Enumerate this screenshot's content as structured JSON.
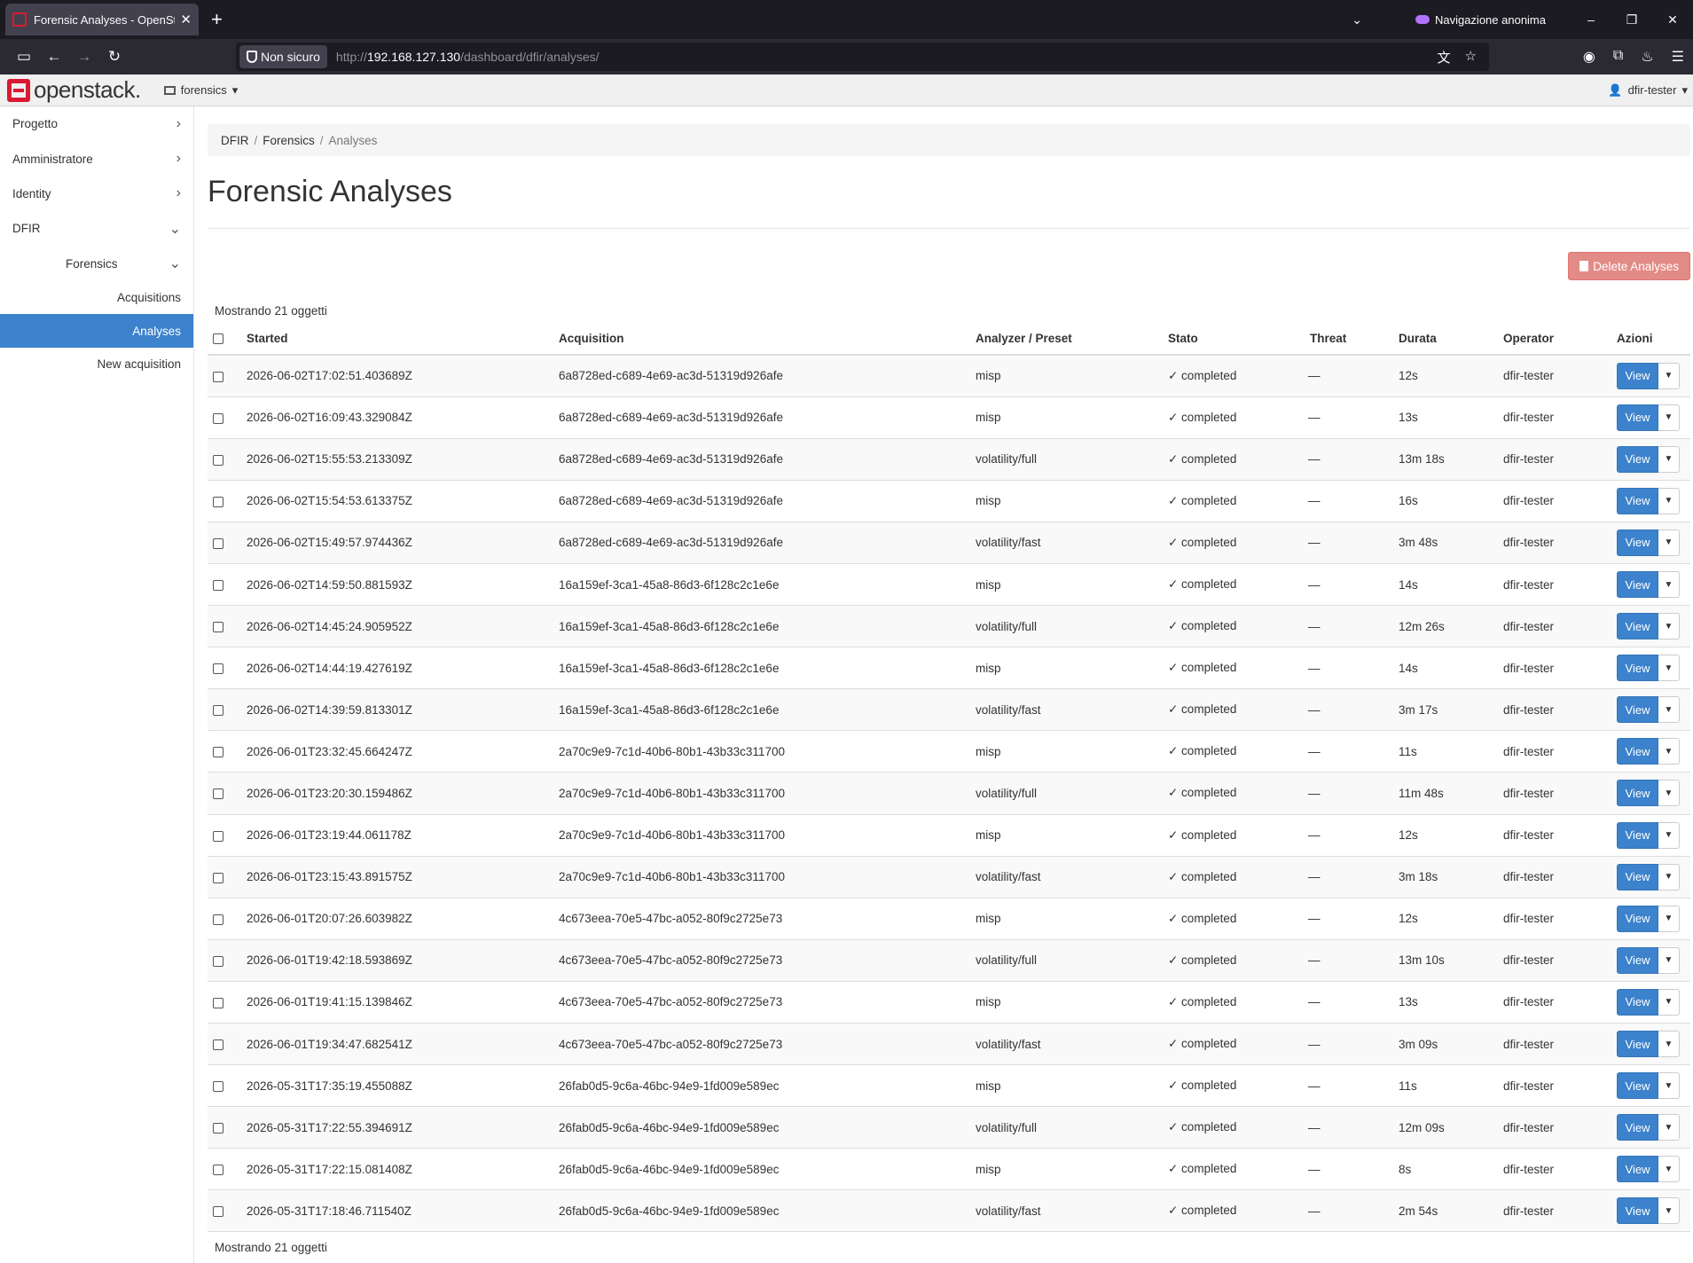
{
  "browser": {
    "tab_title": "Forensic Analyses - OpenStack D",
    "tab_close": "✕",
    "new_tab": "+",
    "private_label": "Navigazione anonima",
    "insecure_label": "Non sicuro",
    "url_prefix": "http://",
    "url_host": "192.168.127.130",
    "url_path": "/dashboard/dfir/analyses/",
    "icons": [
      "sidebar-icon",
      "back-icon",
      "forward-icon",
      "reload-icon",
      "translate-icon",
      "star-icon",
      "account-icon",
      "extensions-icon",
      "firefox-view-icon",
      "menu-icon"
    ]
  },
  "header": {
    "logo_text": "openstack.",
    "project": "forensics",
    "user": "dfir-tester",
    "brand_color": "#da1a32"
  },
  "sidebar": {
    "items": [
      {
        "label": "Progetto"
      },
      {
        "label": "Amministratore"
      },
      {
        "label": "Identity"
      },
      {
        "label": "DFIR"
      }
    ],
    "sub_label": "Forensics",
    "leaves": [
      {
        "label": "Acquisitions"
      },
      {
        "label": "Analyses"
      },
      {
        "label": "New acquisition"
      }
    ],
    "active_color": "#3c82cc"
  },
  "breadcrumb": {
    "b1": "DFIR",
    "b2": "Forensics",
    "b3": "Analyses"
  },
  "page": {
    "title": "Forensic Analyses",
    "delete_label": "Delete Analyses",
    "count_text": "Mostrando 21 oggetti"
  },
  "table": {
    "headers": {
      "started": "Started",
      "acquisition": "Acquisition",
      "analyzer": "Analyzer / Preset",
      "stato": "Stato",
      "threat": "Threat",
      "durata": "Durata",
      "operator": "Operator",
      "azioni": "Azioni"
    },
    "view_label": "View",
    "rows": [
      {
        "started": "2026-06-02T17:02:51.403689Z",
        "acq": "6a8728ed-c689-4e69-ac3d-51319d926afe",
        "analyzer": "misp",
        "stato": "✓ completed",
        "threat": "—",
        "durata": "12s",
        "op": "dfir-tester"
      },
      {
        "started": "2026-06-02T16:09:43.329084Z",
        "acq": "6a8728ed-c689-4e69-ac3d-51319d926afe",
        "analyzer": "misp",
        "stato": "✓ completed",
        "threat": "—",
        "durata": "13s",
        "op": "dfir-tester"
      },
      {
        "started": "2026-06-02T15:55:53.213309Z",
        "acq": "6a8728ed-c689-4e69-ac3d-51319d926afe",
        "analyzer": "volatility/full",
        "stato": "✓ completed",
        "threat": "—",
        "durata": "13m 18s",
        "op": "dfir-tester"
      },
      {
        "started": "2026-06-02T15:54:53.613375Z",
        "acq": "6a8728ed-c689-4e69-ac3d-51319d926afe",
        "analyzer": "misp",
        "stato": "✓ completed",
        "threat": "—",
        "durata": "16s",
        "op": "dfir-tester"
      },
      {
        "started": "2026-06-02T15:49:57.974436Z",
        "acq": "6a8728ed-c689-4e69-ac3d-51319d926afe",
        "analyzer": "volatility/fast",
        "stato": "✓ completed",
        "threat": "—",
        "durata": "3m 48s",
        "op": "dfir-tester"
      },
      {
        "started": "2026-06-02T14:59:50.881593Z",
        "acq": "16a159ef-3ca1-45a8-86d3-6f128c2c1e6e",
        "analyzer": "misp",
        "stato": "✓ completed",
        "threat": "—",
        "durata": "14s",
        "op": "dfir-tester"
      },
      {
        "started": "2026-06-02T14:45:24.905952Z",
        "acq": "16a159ef-3ca1-45a8-86d3-6f128c2c1e6e",
        "analyzer": "volatility/full",
        "stato": "✓ completed",
        "threat": "—",
        "durata": "12m 26s",
        "op": "dfir-tester"
      },
      {
        "started": "2026-06-02T14:44:19.427619Z",
        "acq": "16a159ef-3ca1-45a8-86d3-6f128c2c1e6e",
        "analyzer": "misp",
        "stato": "✓ completed",
        "threat": "—",
        "durata": "14s",
        "op": "dfir-tester"
      },
      {
        "started": "2026-06-02T14:39:59.813301Z",
        "acq": "16a159ef-3ca1-45a8-86d3-6f128c2c1e6e",
        "analyzer": "volatility/fast",
        "stato": "✓ completed",
        "threat": "—",
        "durata": "3m 17s",
        "op": "dfir-tester"
      },
      {
        "started": "2026-06-01T23:32:45.664247Z",
        "acq": "2a70c9e9-7c1d-40b6-80b1-43b33c311700",
        "analyzer": "misp",
        "stato": "✓ completed",
        "threat": "—",
        "durata": "11s",
        "op": "dfir-tester"
      },
      {
        "started": "2026-06-01T23:20:30.159486Z",
        "acq": "2a70c9e9-7c1d-40b6-80b1-43b33c311700",
        "analyzer": "volatility/full",
        "stato": "✓ completed",
        "threat": "—",
        "durata": "11m 48s",
        "op": "dfir-tester"
      },
      {
        "started": "2026-06-01T23:19:44.061178Z",
        "acq": "2a70c9e9-7c1d-40b6-80b1-43b33c311700",
        "analyzer": "misp",
        "stato": "✓ completed",
        "threat": "—",
        "durata": "12s",
        "op": "dfir-tester"
      },
      {
        "started": "2026-06-01T23:15:43.891575Z",
        "acq": "2a70c9e9-7c1d-40b6-80b1-43b33c311700",
        "analyzer": "volatility/fast",
        "stato": "✓ completed",
        "threat": "—",
        "durata": "3m 18s",
        "op": "dfir-tester"
      },
      {
        "started": "2026-06-01T20:07:26.603982Z",
        "acq": "4c673eea-70e5-47bc-a052-80f9c2725e73",
        "analyzer": "misp",
        "stato": "✓ completed",
        "threat": "—",
        "durata": "12s",
        "op": "dfir-tester"
      },
      {
        "started": "2026-06-01T19:42:18.593869Z",
        "acq": "4c673eea-70e5-47bc-a052-80f9c2725e73",
        "analyzer": "volatility/full",
        "stato": "✓ completed",
        "threat": "—",
        "durata": "13m 10s",
        "op": "dfir-tester"
      },
      {
        "started": "2026-06-01T19:41:15.139846Z",
        "acq": "4c673eea-70e5-47bc-a052-80f9c2725e73",
        "analyzer": "misp",
        "stato": "✓ completed",
        "threat": "—",
        "durata": "13s",
        "op": "dfir-tester"
      },
      {
        "started": "2026-06-01T19:34:47.682541Z",
        "acq": "4c673eea-70e5-47bc-a052-80f9c2725e73",
        "analyzer": "volatility/fast",
        "stato": "✓ completed",
        "threat": "—",
        "durata": "3m 09s",
        "op": "dfir-tester"
      },
      {
        "started": "2026-05-31T17:35:19.455088Z",
        "acq": "26fab0d5-9c6a-46bc-94e9-1fd009e589ec",
        "analyzer": "misp",
        "stato": "✓ completed",
        "threat": "—",
        "durata": "11s",
        "op": "dfir-tester"
      },
      {
        "started": "2026-05-31T17:22:55.394691Z",
        "acq": "26fab0d5-9c6a-46bc-94e9-1fd009e589ec",
        "analyzer": "volatility/full",
        "stato": "✓ completed",
        "threat": "—",
        "durata": "12m 09s",
        "op": "dfir-tester"
      },
      {
        "started": "2026-05-31T17:22:15.081408Z",
        "acq": "26fab0d5-9c6a-46bc-94e9-1fd009e589ec",
        "analyzer": "misp",
        "stato": "✓ completed",
        "threat": "—",
        "durata": "8s",
        "op": "dfir-tester"
      },
      {
        "started": "2026-05-31T17:18:46.711540Z",
        "acq": "26fab0d5-9c6a-46bc-94e9-1fd009e589ec",
        "analyzer": "volatility/fast",
        "stato": "✓ completed",
        "threat": "—",
        "durata": "2m 54s",
        "op": "dfir-tester"
      }
    ]
  }
}
